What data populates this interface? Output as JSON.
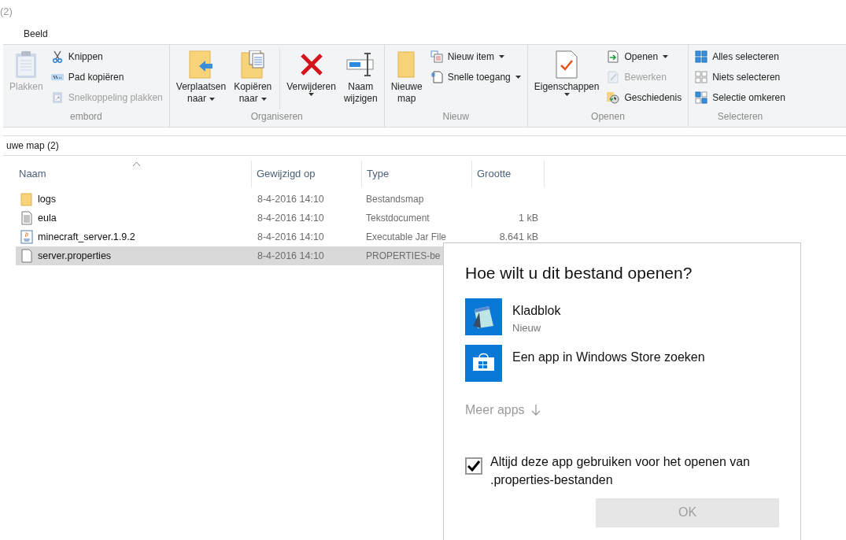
{
  "window": {
    "title": "(2)"
  },
  "ribbon_tabs": [
    {
      "label": "Beeld",
      "selected": false
    }
  ],
  "ribbon": {
    "groups": [
      {
        "label": "embord",
        "buttons": [
          {
            "kind": "large",
            "lines": [
              "Plakken"
            ],
            "disabled": true,
            "menu": false
          },
          {
            "kind": "small",
            "label": "Knippen",
            "disabled": false,
            "menu": false
          },
          {
            "kind": "small",
            "label": "Pad kopiëren",
            "disabled": false,
            "menu": false
          },
          {
            "kind": "small",
            "label": "Snelkoppeling plakken",
            "disabled": true,
            "menu": false
          }
        ]
      },
      {
        "label": "Organiseren",
        "buttons": [
          {
            "kind": "large",
            "lines": [
              "Verplaatsen",
              "naar"
            ],
            "disabled": false,
            "menu": true
          },
          {
            "kind": "large",
            "lines": [
              "Kopiëren",
              "naar"
            ],
            "disabled": false,
            "menu": true
          },
          {
            "kind": "large",
            "lines": [
              "Verwijderen"
            ],
            "disabled": false,
            "menu": true
          },
          {
            "kind": "large",
            "lines": [
              "Naam",
              "wijzigen"
            ],
            "disabled": false,
            "menu": false
          }
        ]
      },
      {
        "label": "Nieuw",
        "buttons": [
          {
            "kind": "large",
            "lines": [
              "Nieuwe",
              "map"
            ],
            "disabled": false,
            "menu": false
          },
          {
            "kind": "small",
            "label": "Nieuw item",
            "disabled": false,
            "menu": true
          },
          {
            "kind": "small",
            "label": "Snelle toegang",
            "disabled": false,
            "menu": true
          }
        ]
      },
      {
        "label": "Openen",
        "buttons": [
          {
            "kind": "large",
            "lines": [
              "Eigenschappen"
            ],
            "disabled": false,
            "menu": true
          },
          {
            "kind": "small",
            "label": "Openen",
            "disabled": false,
            "menu": true
          },
          {
            "kind": "small",
            "label": "Bewerken",
            "disabled": true,
            "menu": false
          },
          {
            "kind": "small",
            "label": "Geschiedenis",
            "disabled": false,
            "menu": false
          }
        ]
      },
      {
        "label": "Selecteren",
        "buttons": [
          {
            "kind": "small",
            "label": "Alles selecteren",
            "disabled": false,
            "menu": false
          },
          {
            "kind": "small",
            "label": "Niets selecteren",
            "disabled": false,
            "menu": false
          },
          {
            "kind": "small",
            "label": "Selectie omkeren",
            "disabled": false,
            "menu": false
          }
        ]
      }
    ]
  },
  "address": "uwe map (2)",
  "table": {
    "columns": [
      {
        "label": "Naam",
        "sorted": true
      },
      {
        "label": "Gewijzigd op",
        "sorted": false
      },
      {
        "label": "Type",
        "sorted": false
      },
      {
        "label": "Grootte",
        "sorted": false
      }
    ],
    "rows": [
      {
        "kind": "folder",
        "name": "logs",
        "modified": "8-4-2016 14:10",
        "type": "Bestandsmap",
        "size": "",
        "selected": false
      },
      {
        "kind": "text",
        "name": "eula",
        "modified": "8-4-2016 14:10",
        "type": "Tekstdocument",
        "size": "1 kB",
        "selected": false
      },
      {
        "kind": "jar",
        "name": "minecraft_server.1.9.2",
        "modified": "8-4-2016 14:10",
        "type": "Executable Jar File",
        "size": "8.641 kB",
        "selected": false
      },
      {
        "kind": "file",
        "name": "server.properties",
        "modified": "8-4-2016 14:10",
        "type": "PROPERTIES-be",
        "size": "",
        "selected": true
      }
    ]
  },
  "dialog": {
    "title": "Hoe wilt u dit bestand openen?",
    "apps": [
      {
        "kind": "notepad",
        "name": "Kladblok",
        "note": "Nieuw"
      },
      {
        "kind": "store",
        "name": "Een app in Windows Store zoeken"
      }
    ],
    "more": "Meer apps",
    "always": {
      "label": "Altijd deze app gebruiken voor het openen van .properties-bestanden",
      "checked": true
    },
    "ok": {
      "label": "OK",
      "disabled": true
    }
  }
}
